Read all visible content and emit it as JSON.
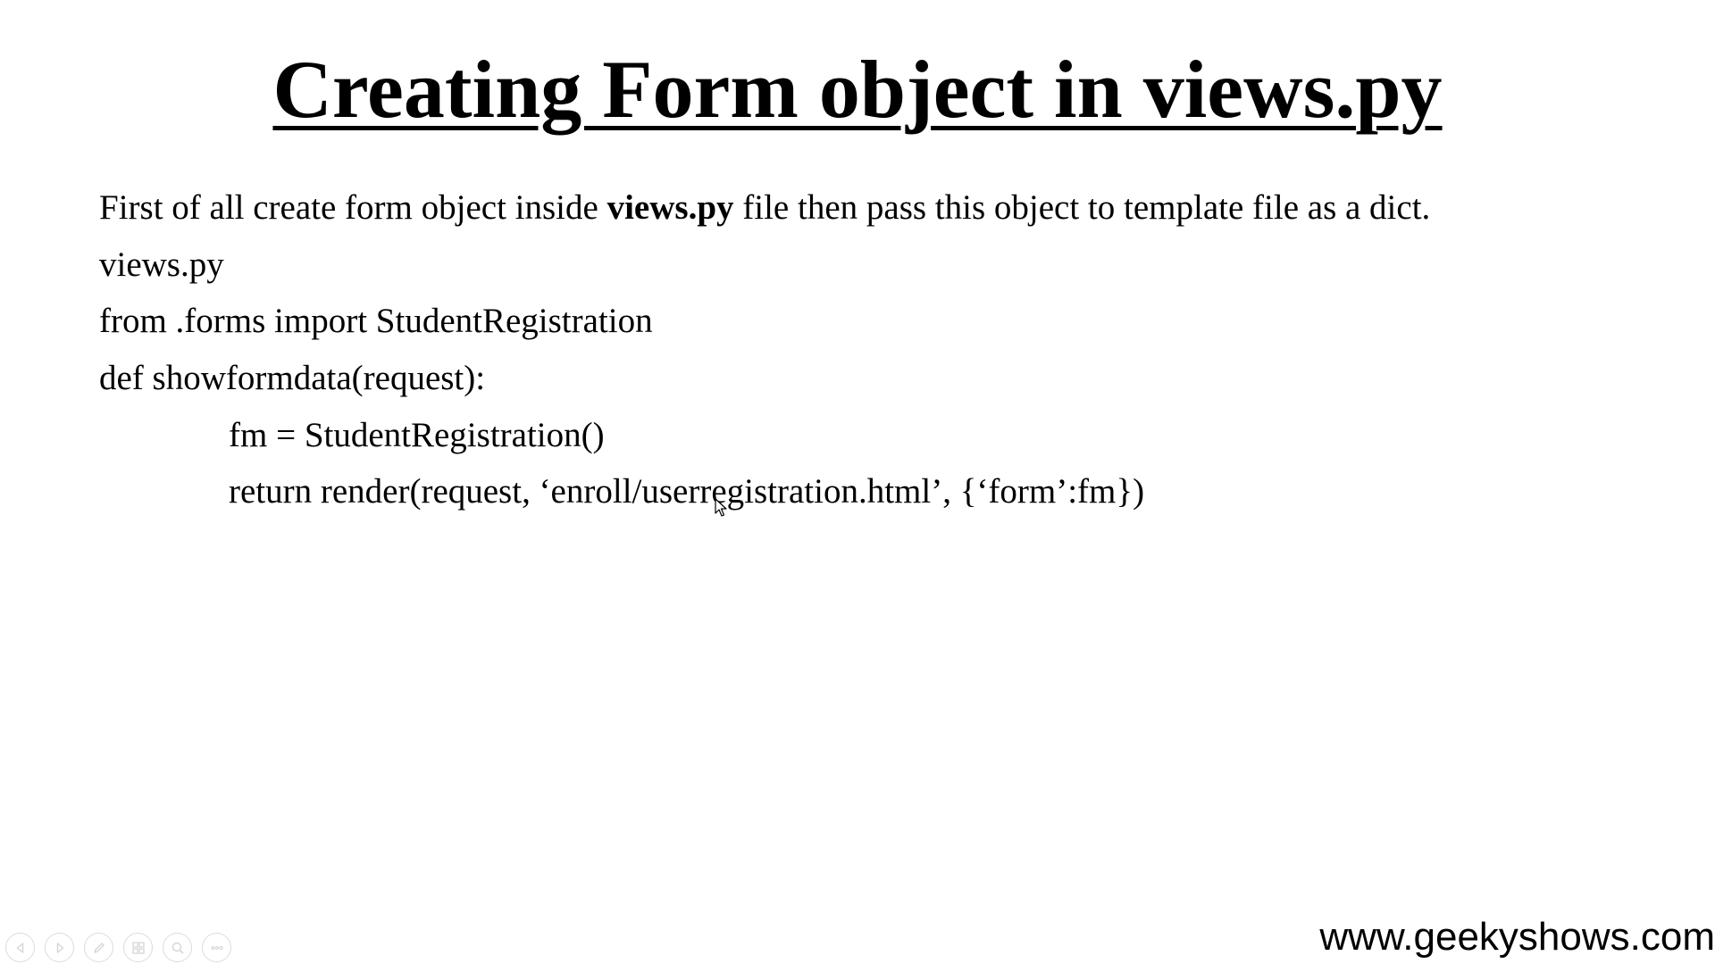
{
  "slide": {
    "title": "Creating Form object in views.py",
    "intro": {
      "before": "First of all create form object inside ",
      "bold": "views.py",
      "after": " file then pass this object to template file as a dict."
    },
    "code_lines": [
      "views.py",
      "from .forms import StudentRegistration",
      "def showformdata(request):",
      "fm = StudentRegistration()",
      "return render(request, ‘enroll/userregistration.html’, {‘form’:fm})"
    ]
  },
  "footer": {
    "url": "www.geekyshows.com"
  },
  "controls": [
    {
      "icon": "previous-icon"
    },
    {
      "icon": "next-icon"
    },
    {
      "icon": "pen-icon"
    },
    {
      "icon": "slides-icon"
    },
    {
      "icon": "zoom-icon"
    },
    {
      "icon": "more-icon"
    }
  ]
}
